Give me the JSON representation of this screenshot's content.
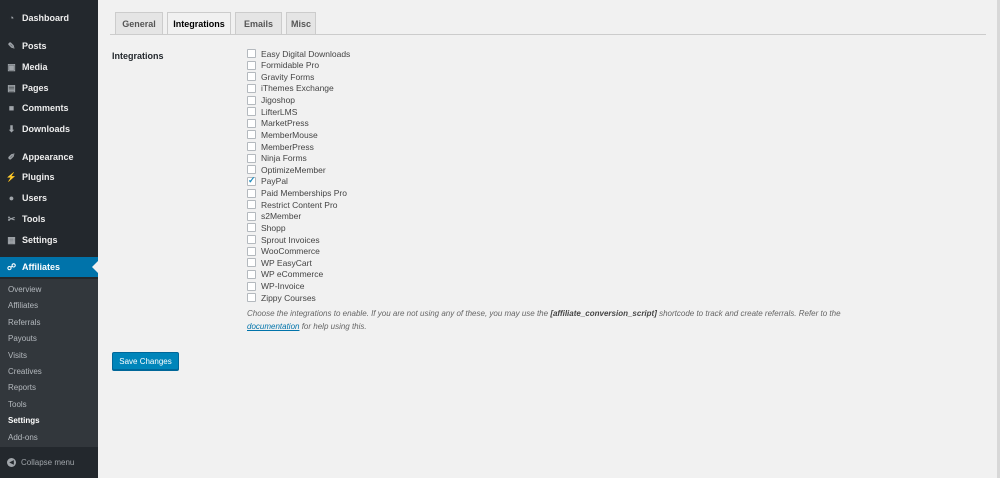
{
  "sidebar": {
    "menu": [
      {
        "label": "Dashboard",
        "icon": "dashboard-icon",
        "glyph": "◔"
      },
      {
        "label": "Posts",
        "icon": "pin-icon",
        "glyph": "✎"
      },
      {
        "label": "Media",
        "icon": "media-icon",
        "glyph": "▣"
      },
      {
        "label": "Pages",
        "icon": "pages-icon",
        "glyph": "▤"
      },
      {
        "label": "Comments",
        "icon": "comments-icon",
        "glyph": "■"
      },
      {
        "label": "Downloads",
        "icon": "download-icon",
        "glyph": "⬇"
      },
      {
        "label": "Appearance",
        "icon": "brush-icon",
        "glyph": "✐"
      },
      {
        "label": "Plugins",
        "icon": "plugin-icon",
        "glyph": "⚡"
      },
      {
        "label": "Users",
        "icon": "user-icon",
        "glyph": "●"
      },
      {
        "label": "Tools",
        "icon": "wrench-icon",
        "glyph": "✂"
      },
      {
        "label": "Settings",
        "icon": "settings-icon",
        "glyph": "▦"
      },
      {
        "label": "Affiliates",
        "icon": "affiliates-icon",
        "glyph": "☍"
      }
    ],
    "submenu": [
      "Overview",
      "Affiliates",
      "Referrals",
      "Payouts",
      "Visits",
      "Creatives",
      "Reports",
      "Tools",
      "Settings",
      "Add-ons"
    ],
    "current_submenu": "Settings",
    "collapse_label": "Collapse menu"
  },
  "tabs": [
    "General",
    "Integrations",
    "Emails",
    "Misc"
  ],
  "active_tab": "Integrations",
  "form": {
    "label": "Integrations",
    "integrations": [
      {
        "name": "Easy Digital Downloads",
        "checked": false
      },
      {
        "name": "Formidable Pro",
        "checked": false
      },
      {
        "name": "Gravity Forms",
        "checked": false
      },
      {
        "name": "iThemes Exchange",
        "checked": false
      },
      {
        "name": "Jigoshop",
        "checked": false
      },
      {
        "name": "LifterLMS",
        "checked": false
      },
      {
        "name": "MarketPress",
        "checked": false
      },
      {
        "name": "MemberMouse",
        "checked": false
      },
      {
        "name": "MemberPress",
        "checked": false
      },
      {
        "name": "Ninja Forms",
        "checked": false
      },
      {
        "name": "OptimizeMember",
        "checked": false
      },
      {
        "name": "PayPal",
        "checked": true
      },
      {
        "name": "Paid Memberships Pro",
        "checked": false
      },
      {
        "name": "Restrict Content Pro",
        "checked": false
      },
      {
        "name": "s2Member",
        "checked": false
      },
      {
        "name": "Shopp",
        "checked": false
      },
      {
        "name": "Sprout Invoices",
        "checked": false
      },
      {
        "name": "WooCommerce",
        "checked": false
      },
      {
        "name": "WP EasyCart",
        "checked": false
      },
      {
        "name": "WP eCommerce",
        "checked": false
      },
      {
        "name": "WP-Invoice",
        "checked": false
      },
      {
        "name": "Zippy Courses",
        "checked": false
      }
    ],
    "description_part1": "Choose the integrations to enable. If you are not using any of these, you may use the ",
    "shortcode": "[affiliate_conversion_script]",
    "description_part2": " shortcode to track and create referrals. Refer to the",
    "doc_link": "documentation",
    "description_part3": " for help using this.",
    "save_label": "Save Changes"
  },
  "colors": {
    "accent": "#0073aa",
    "sidebar_bg": "#23282d",
    "button": "#0085ba"
  }
}
